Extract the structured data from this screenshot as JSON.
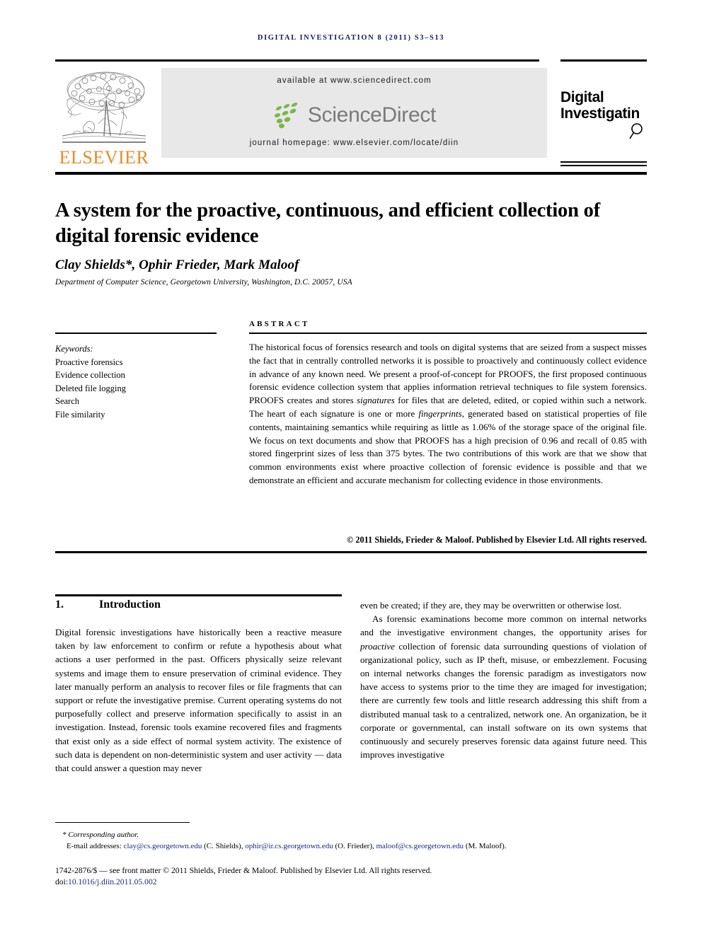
{
  "running_head": "Digital Investigation 8 (2011) S3–S13",
  "header": {
    "publisher_logo_text": "ELSEVIER",
    "available_at": "available at www.sciencedirect.com",
    "sciencedirect_wordmark": "ScienceDirect",
    "journal_homepage": "journal homepage: www.elsevier.com/locate/diin",
    "journal_logo_line1": "Digital",
    "journal_logo_line2": "Investigati",
    "journal_logo_line2_tail": "n"
  },
  "article": {
    "title": "A system for the proactive, continuous, and efficient collection of digital forensic evidence",
    "authors": "Clay Shields*, Ophir Frieder, Mark Maloof",
    "author_star": "*",
    "affiliation": "Department of Computer Science, Georgetown University, Washington, D.C. 20057, USA"
  },
  "abstract": {
    "heading": "Abstract",
    "paragraph_1": "The historical focus of forensics research and tools on digital systems that are seized from a suspect misses the fact that in centrally controlled networks it is possible to proactively and continuously collect evidence in advance of any known need. We present a proof-of-concept for PROOFS, the first proposed continuous forensic evidence collection system that applies information retrieval techniques to file system forensics. PROOFS creates and stores ",
    "italic_1": "signatures",
    "paragraph_2": " for files that are deleted, edited, or copied within such a network. The heart of each signature is one or more ",
    "italic_2": "fingerprints",
    "paragraph_3": ", generated based on statistical properties of file contents, maintaining semantics while requiring as little as 1.06% of the storage space of the original file. We focus on text documents and show that PROOFS has a high precision of 0.96 and recall of 0.85 with stored fingerprint sizes of less than 375 bytes. The two contributions of this work are that we show that common environments exist where proactive collection of forensic evidence is possible and that we demonstrate an efficient and accurate mechanism for collecting evidence in those environments.",
    "copyright": "© 2011 Shields, Frieder & Maloof. Published by Elsevier Ltd. All rights reserved."
  },
  "keywords": {
    "label": "Keywords:",
    "items": [
      "Proactive forensics",
      "Evidence collection",
      "Deleted file logging",
      "Search",
      "File similarity"
    ]
  },
  "section": {
    "number": "1.",
    "title": "Introduction",
    "left_column": "Digital forensic investigations have historically been a reactive measure taken by law enforcement to confirm or refute a hypothesis about what actions a user performed in the past. Officers physically seize relevant systems and image them to ensure preservation of criminal evidence. They later manually perform an analysis to recover files or file fragments that can support or refute the investigative premise. Current operating systems do not purposefully collect and preserve information specifically to assist in an investigation. Instead, forensic tools examine recovered files and fragments that exist only as a side effect of normal system activity. The existence of such data is dependent on non-deterministic system and user activity — data that could answer a question may never",
    "right_column_p1": "even be created; if they are, they may be overwritten or otherwise lost.",
    "right_column_p2_a": "As forensic examinations become more common on internal networks and the investigative environment changes, the opportunity arises for ",
    "right_column_p2_italic": "proactive",
    "right_column_p2_b": " collection of forensic data surrounding questions of violation of organizational policy, such as IP theft, misuse, or embezzlement. Focusing on internal networks changes the forensic paradigm as investigators now have access to systems prior to the time they are imaged for investigation; there are currently few tools and little research addressing this shift from a distributed manual task to a centralized, network one. An organization, be it corporate or governmental, can install software on its own systems that continuously and securely preserves forensic data against future need. This improves investigative"
  },
  "footnote": {
    "corresponding_author": "* Corresponding author.",
    "emails_label": "E-mail addresses:",
    "email_1": "clay@cs.georgetown.edu",
    "email_1_attrib": "(C. Shields),",
    "email_2": "ophir@ir.cs.georgetown.edu",
    "email_2_attrib": "(O. Frieder),",
    "email_3": "maloof@cs.georgetown.edu",
    "email_3_attrib": "(M. Maloof).",
    "front_matter": "1742-2876/$ — see front matter © 2011 Shields, Frieder & Maloof. Published by Elsevier Ltd. All rights reserved.",
    "doi_label": "doi:",
    "doi_value": "10.1016/j.diin.2011.05.002"
  },
  "colors": {
    "running_head": "#151a5c",
    "elsevier_orange": "#eb8a27",
    "sciencedirect_green": "#7ab648",
    "sciencedirect_gray": "#7a7a7a",
    "banner_bg": "#e8e8e8",
    "link_blue": "#1a2a82"
  }
}
